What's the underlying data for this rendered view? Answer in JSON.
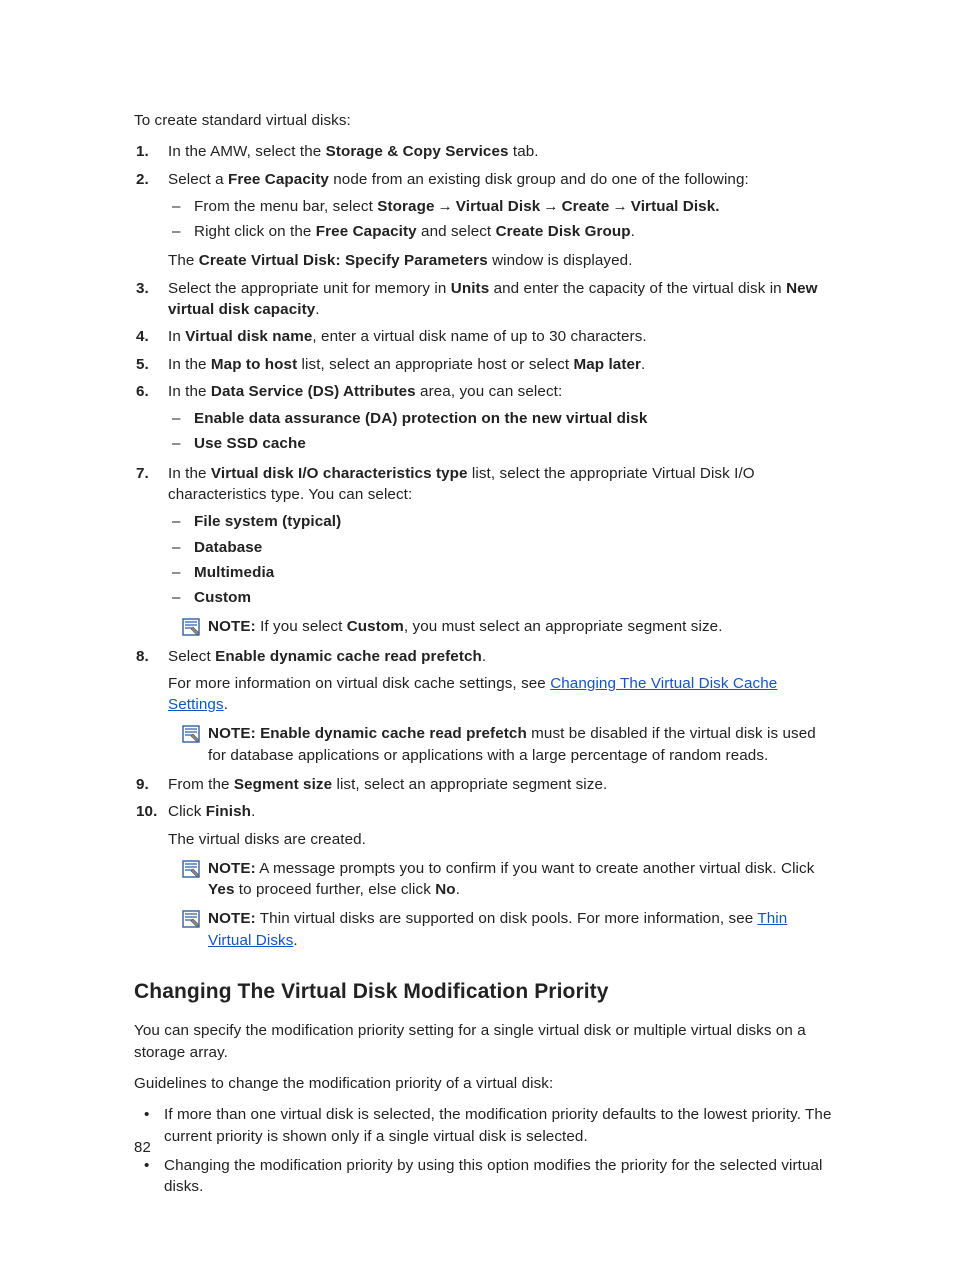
{
  "intro": "To create standard virtual disks:",
  "page_number": "82",
  "steps": {
    "s1": {
      "pre": "In the AMW, select the ",
      "b1": "Storage & Copy Services",
      "post": " tab."
    },
    "s2": {
      "pre": "Select a ",
      "b1": "Free Capacity",
      "post": " node from an existing disk group and do one of the following:",
      "d1": {
        "pre": "From the menu bar, select ",
        "b1": "Storage",
        "b2": "Virtual Disk",
        "b3": "Create",
        "b4": "Virtual Disk."
      },
      "d2": {
        "pre": "Right click on the ",
        "b1": "Free Capacity",
        "mid": " and select ",
        "b2": "Create Disk Group",
        "post": "."
      },
      "after": {
        "pre": "The ",
        "b1": "Create Virtual Disk: Specify Parameters",
        "post": " window is displayed."
      }
    },
    "s3": {
      "pre": "Select the appropriate unit for memory in ",
      "b1": "Units",
      "mid": " and enter the capacity of the virtual disk in ",
      "b2": "New virtual disk capacity",
      "post": "."
    },
    "s4": {
      "pre": "In ",
      "b1": "Virtual disk name",
      "post": ", enter a virtual disk name of up to 30 characters."
    },
    "s5": {
      "pre": "In the ",
      "b1": "Map to host",
      "mid": " list, select an appropriate host or select ",
      "b2": "Map later",
      "post": "."
    },
    "s6": {
      "pre": "In the ",
      "b1": "Data Service (DS) Attributes",
      "post": " area, you can select:",
      "d1": "Enable data assurance (DA) protection on the new virtual disk",
      "d2": "Use SSD cache"
    },
    "s7": {
      "pre": "In the ",
      "b1": "Virtual disk I/O characteristics type",
      "post": " list, select the appropriate Virtual Disk I/O characteristics type. You can select:",
      "d1": "File system (typical)",
      "d2": "Database",
      "d3": "Multimedia",
      "d4": "Custom",
      "note": {
        "label": "NOTE:",
        "pre": " If you select ",
        "b1": "Custom",
        "post": ", you must select an appropriate segment size."
      }
    },
    "s8": {
      "pre": "Select ",
      "b1": "Enable dynamic cache read prefetch",
      "post": ".",
      "line2a": "For more information on virtual disk cache settings, see ",
      "link": "Changing The Virtual Disk Cache Settings",
      "line2b": ".",
      "note": {
        "label": "NOTE:",
        "b1": "Enable dynamic cache read prefetch",
        "post": " must be disabled if the virtual disk is used for database applications or applications with a large percentage of random reads."
      }
    },
    "s9": {
      "pre": "From the ",
      "b1": "Segment size",
      "post": " list, select an appropriate segment size."
    },
    "s10": {
      "pre": "Click ",
      "b1": "Finish",
      "post": ".",
      "line2": "The virtual disks are created.",
      "note1": {
        "label": "NOTE:",
        "pre": " A message prompts you to confirm if you want to create another virtual disk. Click ",
        "b1": "Yes",
        "mid": " to proceed further, else click ",
        "b2": "No",
        "post": "."
      },
      "note2": {
        "label": "NOTE:",
        "pre": " Thin virtual disks are supported on disk pools. For more information, see ",
        "link": "Thin Virtual Disks",
        "post": "."
      }
    }
  },
  "section2": {
    "heading": "Changing The Virtual Disk Modification Priority",
    "p1": "You can specify the modification priority setting for a single virtual disk or multiple virtual disks on a storage array.",
    "p2": "Guidelines to change the modification priority of a virtual disk:",
    "b1": "If more than one virtual disk is selected, the modification priority defaults to the lowest priority. The current priority is shown only if a single virtual disk is selected.",
    "b2": "Changing the modification priority by using this option modifies the priority for the selected virtual disks."
  }
}
